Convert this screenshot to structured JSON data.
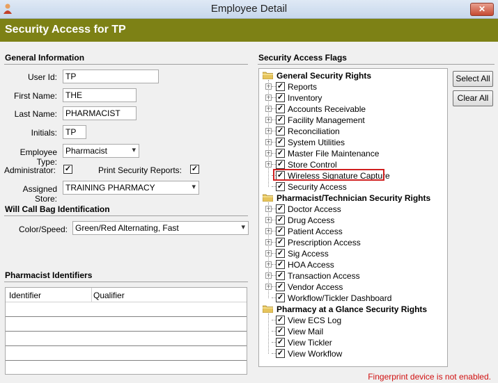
{
  "window": {
    "title": "Employee Detail",
    "close_glyph": "✕",
    "icon": "person-icon"
  },
  "header": {
    "title": "Security Access for TP"
  },
  "general": {
    "title": "General Information",
    "user_id_label": "User Id:",
    "user_id": "TP",
    "first_name_label": "First Name:",
    "first_name": "THE",
    "last_name_label": "Last Name:",
    "last_name": "PHARMACIST",
    "initials_label": "Initials:",
    "initials": "TP",
    "employee_type_label": "Employee Type:",
    "employee_type": "Pharmacist",
    "administrator_label": "Administrator:",
    "administrator_checked": "✓",
    "print_reports_label": "Print Security Reports:",
    "print_reports_checked": "✓",
    "assigned_store_label": "Assigned Store:",
    "assigned_store": "TRAINING PHARMACY"
  },
  "will_call": {
    "title": "Will Call Bag Identification",
    "color_speed_label": "Color/Speed:",
    "color_speed": "Green/Red Alternating, Fast"
  },
  "pharmacist_ids": {
    "title": "Pharmacist Identifiers",
    "columns": [
      "Identifier",
      "Qualifier"
    ]
  },
  "flags": {
    "title": "Security Access Flags",
    "groups": [
      {
        "label": "General Security Rights",
        "items": [
          "Reports",
          "Inventory",
          "Accounts Receivable",
          "Facility Management",
          "Reconciliation",
          "System Utilities",
          "Master File Maintenance",
          "Store Control",
          "Wireless Signature Capture",
          "Security Access"
        ]
      },
      {
        "label": "Pharmacist/Technician Security Rights",
        "items": [
          "Doctor Access",
          "Drug Access",
          "Patient Access",
          "Prescription Access",
          "Sig Access",
          "HOA Access",
          "Transaction Access",
          "Vendor Access",
          "Workflow/Tickler Dashboard"
        ]
      },
      {
        "label": "Pharmacy at a Glance Security Rights",
        "items": [
          "View ECS Log",
          "View Mail",
          "View Tickler",
          "View Workflow"
        ]
      }
    ],
    "check": "✓",
    "expand": "+",
    "highlighted_item": "Wireless Signature Capture"
  },
  "buttons": {
    "select_all": "Select All",
    "clear_all": "Clear All"
  },
  "status": {
    "message": "Fingerprint device is not enabled."
  }
}
